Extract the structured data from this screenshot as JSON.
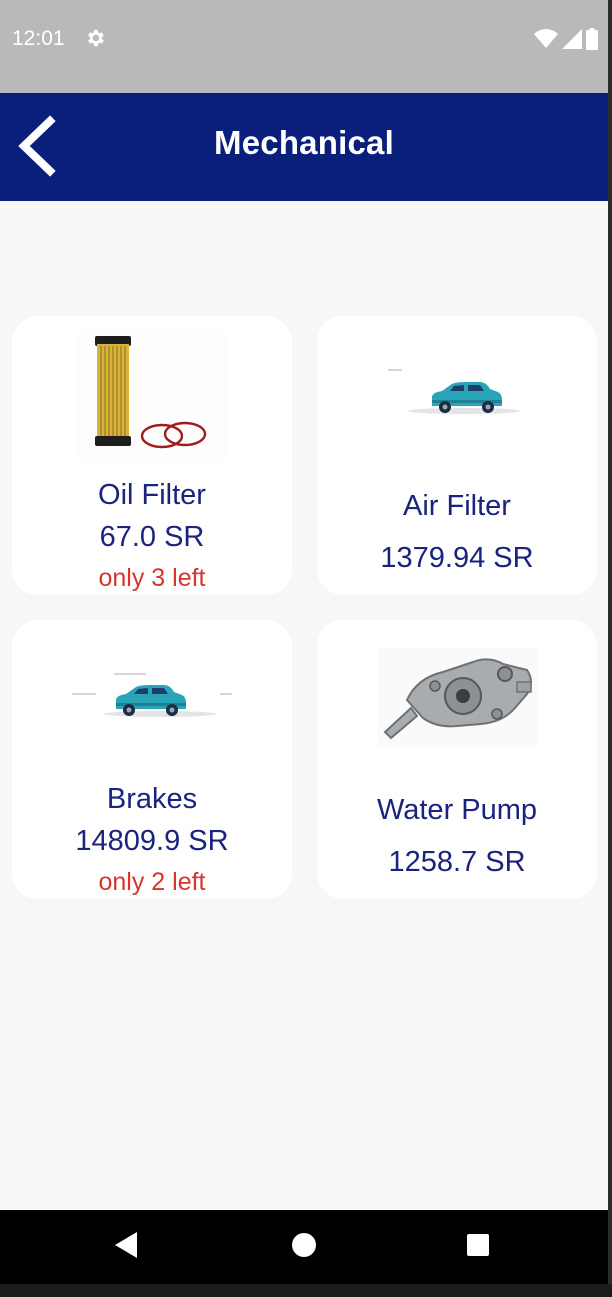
{
  "status_bar": {
    "time": "12:01"
  },
  "app_bar": {
    "title": "Mechanical"
  },
  "products": [
    {
      "name": "Oil Filter",
      "price": "67.0 SR",
      "stock": "only 3 left"
    },
    {
      "name": "Air Filter",
      "price": "1379.94 SR",
      "stock": ""
    },
    {
      "name": "Brakes",
      "price": "14809.9 SR",
      "stock": "only 2 left"
    },
    {
      "name": "Water Pump",
      "price": "1258.7 SR",
      "stock": ""
    }
  ],
  "colors": {
    "app_bar": "#0a1f7c",
    "text": "#1a237e",
    "stock_warning": "#d9342b",
    "status_bar": "#b9b9b9"
  },
  "icons": {
    "back": "chevron-left-icon",
    "settings": "gear-icon",
    "wifi": "wifi-icon",
    "signal": "signal-icon",
    "battery": "battery-icon",
    "nav_back": "triangle-back-icon",
    "nav_home": "circle-home-icon",
    "nav_recents": "square-recents-icon"
  }
}
